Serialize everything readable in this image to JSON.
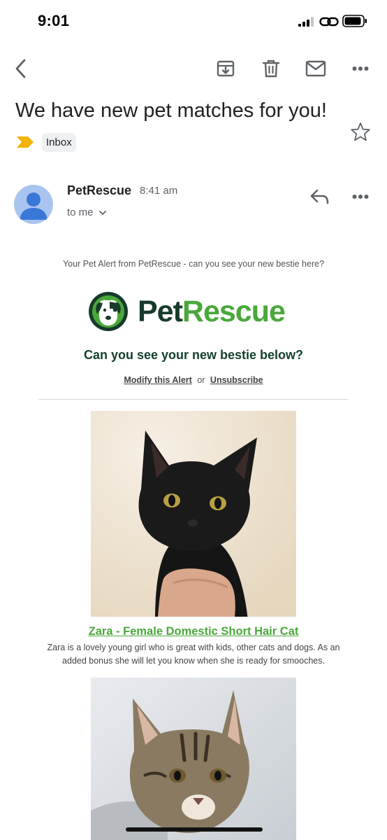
{
  "status_bar": {
    "time": "9:01"
  },
  "toolbar": {
    "back_icon": "chevron-left-icon",
    "archive_icon": "archive-icon",
    "delete_icon": "trash-icon",
    "mark_unread_icon": "mail-icon",
    "more_icon": "more-horizontal-icon"
  },
  "email": {
    "subject": "We have new pet matches for you!",
    "label": "Inbox",
    "sender": "PetRescue",
    "time": "8:41 am",
    "recipient": "to me"
  },
  "body": {
    "preheader": "Your Pet Alert from PetRescue - can you see your new bestie here?",
    "logo": {
      "part1": "Pet",
      "part2": "Rescue"
    },
    "headline": "Can you see your new bestie below?",
    "modify_link": "Modify this Alert",
    "or_text": "or",
    "unsubscribe_link": "Unsubscribe",
    "pets": [
      {
        "title": "Zara - Female Domestic Short Hair Cat",
        "description": "Zara is a lovely young girl who is great with kids, other cats and dogs. As an added bonus she will let you know when she is ready for smooches."
      }
    ]
  },
  "colors": {
    "brand_dark": "#173b2a",
    "brand_green": "#4aa83b",
    "importance_marker": "#f2b400"
  }
}
